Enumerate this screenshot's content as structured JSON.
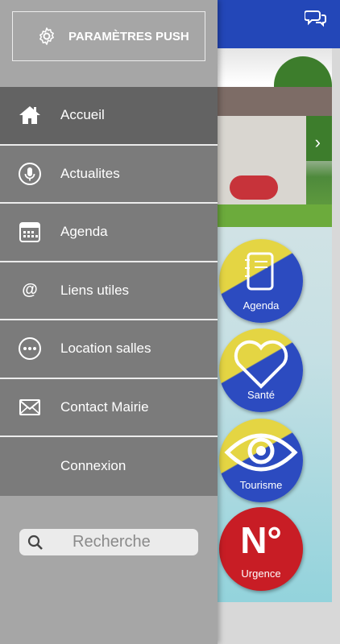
{
  "drawer": {
    "push_settings_label": "PARAMÈTRES PUSH",
    "menu": [
      {
        "label": "Accueil",
        "icon": "home-icon",
        "active": true
      },
      {
        "label": "Actualites",
        "icon": "microphone-icon"
      },
      {
        "label": "Agenda",
        "icon": "calendar-icon"
      },
      {
        "label": "Liens utiles",
        "icon": "at-icon"
      },
      {
        "label": "Location salles",
        "icon": "more-circle-icon"
      },
      {
        "label": "Contact Mairie",
        "icon": "envelope-icon"
      },
      {
        "label": "Connexion",
        "icon": ""
      }
    ],
    "search_placeholder": "Recherche"
  },
  "background": {
    "tiles": [
      {
        "label": "Agenda",
        "icon": "notebook-icon"
      },
      {
        "label": "Santé",
        "icon": "heart-icon"
      },
      {
        "label": "Tourisme",
        "icon": "eye-icon"
      },
      {
        "label": "Urgence",
        "icon": "n-degree-icon",
        "symbol": "N°"
      }
    ]
  },
  "colors": {
    "topbar": "#2347b8",
    "drawer_bg": "#a6a6a6",
    "menu_item": "#7b7b7b",
    "menu_item_active": "#636363",
    "tile_yellow": "#e4d543",
    "tile_blue": "#2c4bc0",
    "urgence_red": "#c81d25"
  }
}
